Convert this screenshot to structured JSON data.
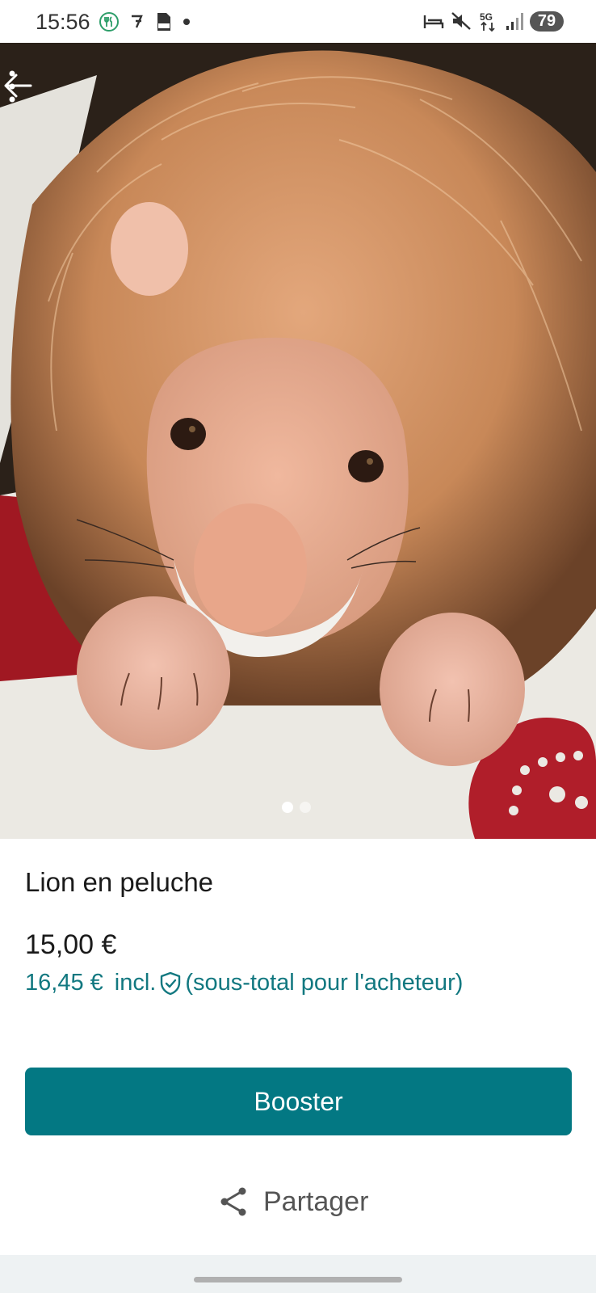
{
  "status_bar": {
    "time": "15:56",
    "battery": "79",
    "network": "5G",
    "left_icons": [
      "restaurant-icon",
      "app-icon",
      "pdf-icon",
      "dot-icon"
    ],
    "right_icons": [
      "bed-icon",
      "mute-icon",
      "5g-icon",
      "signal-icon",
      "battery-icon"
    ]
  },
  "gallery": {
    "image_count": 2,
    "active_index": 0
  },
  "listing": {
    "title": "Lion en peluche",
    "price": "15,00 €",
    "buyer_price": "16,45 €",
    "incl_label": "incl.",
    "buyer_note": "(sous-total pour l'acheteur)"
  },
  "actions": {
    "booster_label": "Booster",
    "share_label": "Partager"
  },
  "colors": {
    "accent": "#037883",
    "buyer_text": "#127880"
  }
}
